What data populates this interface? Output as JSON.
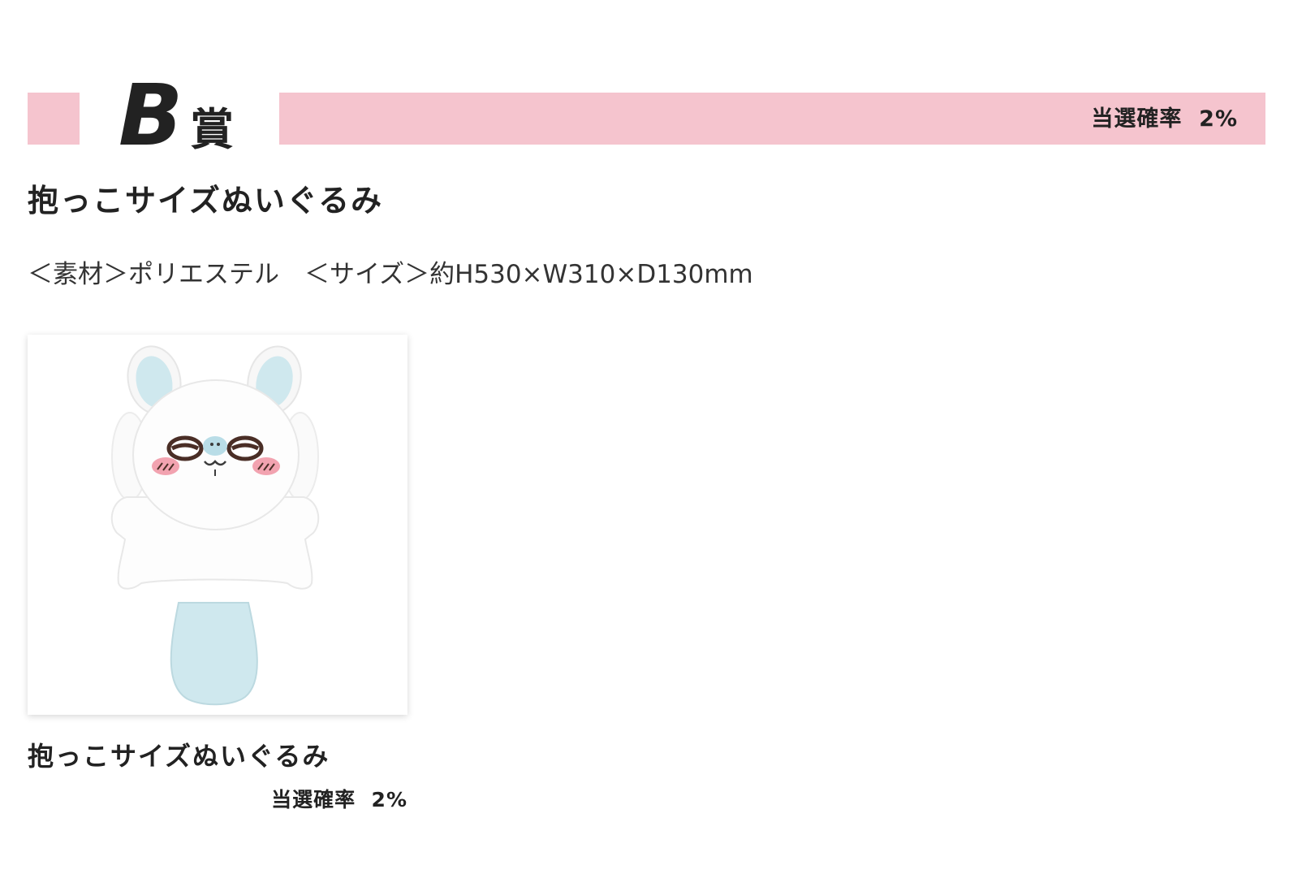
{
  "prize": {
    "rank_letter": "B",
    "rank_suffix": "賞",
    "win_rate": "当選確率  2%"
  },
  "product": {
    "title": "抱っこサイズぬいぐるみ",
    "spec": "＜素材＞ポリエステル　＜サイズ＞約H530×W310×D130mm"
  },
  "card": {
    "title": "抱っこサイズぬいぐるみ",
    "win_rate": "当選確率  2%"
  },
  "colors": {
    "accent_pink": "#f5c4ce",
    "plush_white": "#fdfdfd",
    "plush_blue": "#cfe8ee",
    "cheek_pink": "#f2a3b0"
  }
}
